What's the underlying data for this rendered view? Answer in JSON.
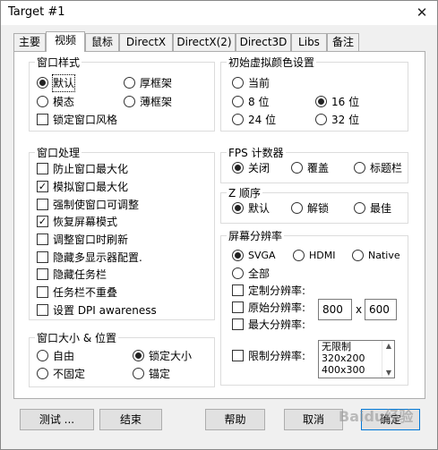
{
  "window": {
    "title": "Target #1",
    "close_glyph": "✕"
  },
  "tabs": [
    "主要",
    "视频",
    "鼠标",
    "DirectX",
    "DirectX(2)",
    "Direct3D",
    "Libs",
    "备注"
  ],
  "active_tab": "视频",
  "window_style": {
    "label": "窗口样式",
    "options": [
      {
        "label": "默认",
        "checked": true
      },
      {
        "label": "厚框架",
        "checked": false
      },
      {
        "label": "模态",
        "checked": false
      },
      {
        "label": "薄框架",
        "checked": false
      }
    ],
    "lock_label": "锁定窗口风格",
    "lock_checked": false
  },
  "virtual_color": {
    "label": "初始虚拟颜色设置",
    "options": [
      {
        "label": "当前",
        "checked": false
      },
      {
        "label": "8 位",
        "checked": false
      },
      {
        "label": "16 位",
        "checked": true
      },
      {
        "label": "24 位",
        "checked": false
      },
      {
        "label": "32 位",
        "checked": false
      }
    ]
  },
  "window_processing": {
    "label": "窗口处理",
    "items": [
      {
        "label": "防止窗口最大化",
        "checked": false
      },
      {
        "label": "模拟窗口最大化",
        "checked": true
      },
      {
        "label": "强制使窗口可调整",
        "checked": false
      },
      {
        "label": "恢复屏幕模式",
        "checked": true
      },
      {
        "label": "调整窗口时刷新",
        "checked": false
      },
      {
        "label": "隐藏多显示器配置.",
        "checked": false
      },
      {
        "label": "隐藏任务栏",
        "checked": false
      },
      {
        "label": "任务栏不重叠",
        "checked": false
      },
      {
        "label": "设置 DPI awareness",
        "checked": false
      }
    ]
  },
  "window_size": {
    "label": "窗口大小 & 位置",
    "options": [
      {
        "label": "自由",
        "checked": false
      },
      {
        "label": "锁定大小",
        "checked": true
      },
      {
        "label": "不固定",
        "checked": false
      },
      {
        "label": "锚定",
        "checked": false
      }
    ]
  },
  "fps": {
    "label": "FPS 计数器",
    "options": [
      {
        "label": "关闭",
        "checked": true
      },
      {
        "label": "覆盖",
        "checked": false
      },
      {
        "label": "标题栏",
        "checked": false
      }
    ]
  },
  "z_order": {
    "label": "Z 顺序",
    "options": [
      {
        "label": "默认",
        "checked": true
      },
      {
        "label": "解锁",
        "checked": false
      },
      {
        "label": "最佳",
        "checked": false
      }
    ]
  },
  "resolution": {
    "label": "屏幕分辨率",
    "modes": [
      {
        "label": "SVGA",
        "checked": true
      },
      {
        "label": "HDMI",
        "checked": false
      },
      {
        "label": "Native",
        "checked": false
      },
      {
        "label": "全部",
        "checked": false
      }
    ],
    "custom_label": "定制分辨率:",
    "initial_label": "原始分辨率:",
    "max_label": "最大分辨率:",
    "width": "800",
    "times": "x",
    "height": "600",
    "limit_label": "限制分辨率:",
    "limit_list": [
      "无限制",
      "320x200",
      "400x300"
    ]
  },
  "buttons": {
    "test": "测试 ...",
    "end": "结束",
    "help": "帮助",
    "cancel": "取消",
    "ok": "确定"
  },
  "watermark": "Baidu经验"
}
